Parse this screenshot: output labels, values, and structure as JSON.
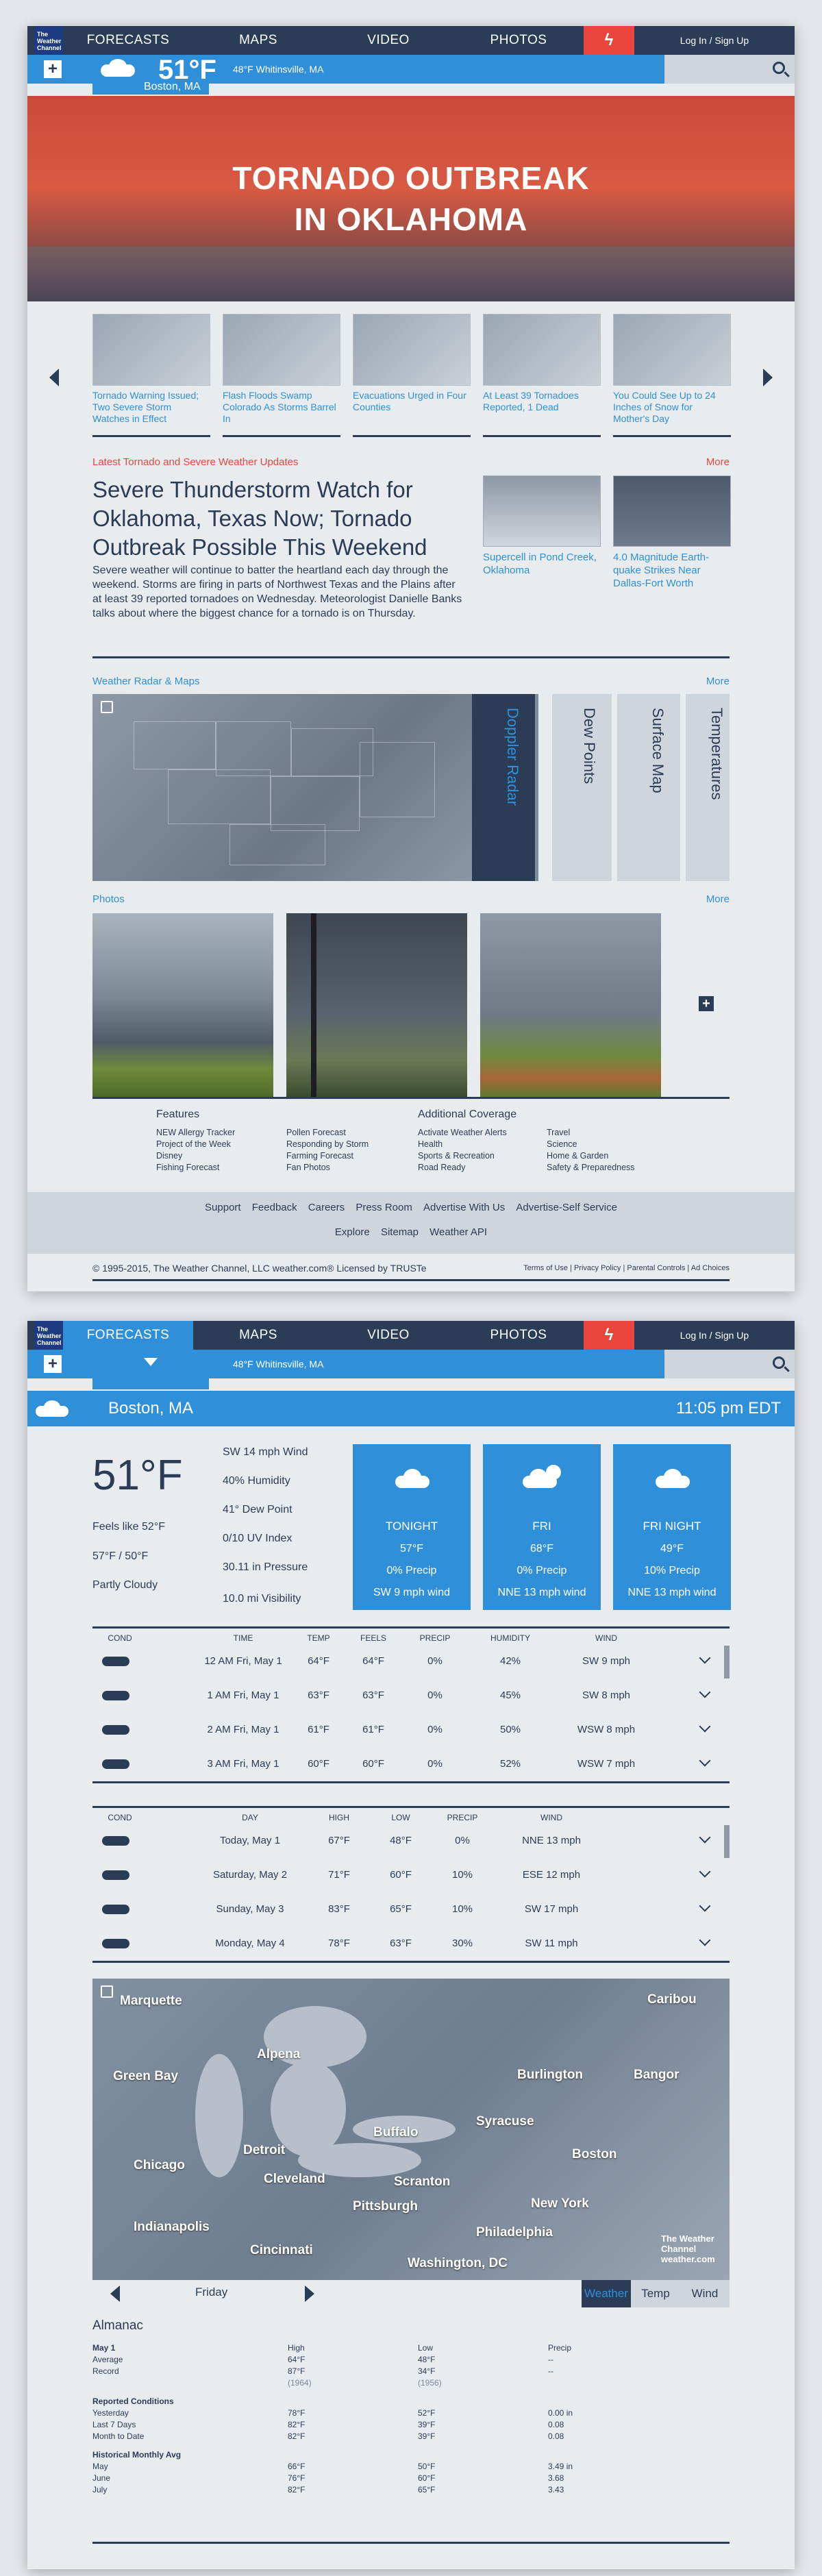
{
  "nav": {
    "logo": "The Weather Channel",
    "items": [
      "FORECASTS",
      "MAPS",
      "VIDEO",
      "PHOTOS"
    ],
    "login": "Log In / Sign Up",
    "location_small": "48°F Whitinsville, MA",
    "plus_glyph": "+",
    "bolt_glyph": "ϟ"
  },
  "current_badge": {
    "temp": "51°F",
    "city": "Boston, MA"
  },
  "hero": {
    "line1": "TORNADO OUTBREAK",
    "line2": "IN OKLAHOMA"
  },
  "thumbs": [
    {
      "caption": "Tornado Warning Issued; Two Severe Storm Watches in Effect"
    },
    {
      "caption": "Flash Floods Swamp Colorado As Storms Barrel In"
    },
    {
      "caption": "Evacuations Urged in Four Counties"
    },
    {
      "caption": "At Least 39 Tornadoes Reported, 1 Dead"
    },
    {
      "caption": "You Could See Up to 24 Inches of Snow for Mother's Day"
    }
  ],
  "latest": {
    "section_title": "Latest Tornado and Severe Weather Updates",
    "more": "More",
    "headline": "Severe Thunderstorm Watch for Oklahoma, Texas Now; Tornado Outbreak Possible This Weekend",
    "dek": "Severe weather will continue to batter the heartland each day through the weekend. Storms are firing in parts of Northwest Texas and the Plains after at least 39 reported tornadoes on Wednesday. Meteorologist Danielle Banks talks about where the biggest chance for a tornado is on Thursday.",
    "side": [
      {
        "caption": "Supercell in Pond Creek, Oklahoma"
      },
      {
        "caption": "4.0 Magnitude Earth-quake Strikes Near Dallas-Fort Worth"
      }
    ]
  },
  "radar": {
    "section_title": "Weather Radar & Maps",
    "more": "More",
    "tabs": [
      "Doppler Radar",
      "Dew Points",
      "Surface Map",
      "Temperatures"
    ]
  },
  "photos": {
    "section_title": "Photos",
    "more": "More",
    "plus_glyph": "+"
  },
  "features": {
    "col1_title": "Features",
    "col1": [
      "NEW Allergy Tracker",
      "Project of the Week",
      "Disney",
      "Fishing Forecast"
    ],
    "col2": [
      "Pollen Forecast",
      "Responding by Storm",
      "Farming Forecast",
      "Fan Photos"
    ],
    "col3_title": "Additional Coverage",
    "col3": [
      "Activate Weather Alerts",
      "Health",
      "Sports & Recreation",
      "Road Ready"
    ],
    "col4": [
      "Travel",
      "Science",
      "Home & Garden",
      "Safety & Preparedness"
    ]
  },
  "footer": {
    "row1": [
      "Support",
      "Feedback",
      "Careers",
      "Press Room",
      "Advertise With Us",
      "Advertise-Self Service"
    ],
    "row2": [
      "Explore",
      "Sitemap",
      "Weather API"
    ],
    "copyright": "© 1995-2015, The Weather Channel, LLC weather.com® Licensed by TRUSTe",
    "legal": "Terms of Use | Privacy Policy | Parental Controls | Ad Choices"
  },
  "page2": {
    "location_bar": {
      "city": "Boston, MA",
      "time": "11:05 pm EDT"
    },
    "current": {
      "temp": "51°F",
      "feels_like": "Feels like 52°F",
      "hi_lo": "57°F / 50°F",
      "condition": "Partly Cloudy",
      "details": [
        "SW 14 mph Wind",
        "40% Humidity",
        "41° Dew Point",
        "0/10 UV Index",
        "30.11 in Pressure",
        "10.0 mi Visibility"
      ]
    },
    "forecast_cards": [
      {
        "name": "TONIGHT",
        "temp": "57°F",
        "precip": "0% Precip",
        "wind": "SW 9 mph wind"
      },
      {
        "name": "FRI",
        "temp": "68°F",
        "precip": "0% Precip",
        "wind": "NNE 13 mph wind"
      },
      {
        "name": "FRI NIGHT",
        "temp": "49°F",
        "precip": "10% Precip",
        "wind": "NNE 13 mph wind"
      }
    ],
    "hourly": {
      "headers": [
        "COND",
        "TIME",
        "TEMP",
        "FEELS",
        "PRECIP",
        "HUMIDITY",
        "WIND"
      ],
      "rows": [
        {
          "time": "12 AM Fri, May 1",
          "temp": "64°F",
          "feels": "64°F",
          "precip": "0%",
          "humidity": "42%",
          "wind": "SW 9 mph"
        },
        {
          "time": "1 AM Fri, May 1",
          "temp": "63°F",
          "feels": "63°F",
          "precip": "0%",
          "humidity": "45%",
          "wind": "SW 8 mph"
        },
        {
          "time": "2 AM Fri, May 1",
          "temp": "61°F",
          "feels": "61°F",
          "precip": "0%",
          "humidity": "50%",
          "wind": "WSW 8 mph"
        },
        {
          "time": "3 AM Fri, May 1",
          "temp": "60°F",
          "feels": "60°F",
          "precip": "0%",
          "humidity": "52%",
          "wind": "WSW 7 mph"
        }
      ]
    },
    "daily": {
      "headers": [
        "COND",
        "DAY",
        "HIGH",
        "LOW",
        "PRECIP",
        "WIND"
      ],
      "rows": [
        {
          "day": "Today, May 1",
          "high": "67°F",
          "low": "48°F",
          "precip": "0%",
          "wind": "NNE 13 mph"
        },
        {
          "day": "Saturday, May 2",
          "high": "71°F",
          "low": "60°F",
          "precip": "10%",
          "wind": "ESE 12 mph"
        },
        {
          "day": "Sunday, May 3",
          "high": "83°F",
          "low": "65°F",
          "precip": "10%",
          "wind": "SW 17 mph"
        },
        {
          "day": "Monday, May 4",
          "high": "78°F",
          "low": "63°F",
          "precip": "30%",
          "wind": "SW 11 mph"
        }
      ]
    },
    "map": {
      "labels": [
        "Marquette",
        "Alpena",
        "Green Bay",
        "Burlington",
        "Bangor",
        "Caribou",
        "Buffalo",
        "Syracuse",
        "Chicago",
        "Detroit",
        "Cleveland",
        "Boston",
        "Scranton",
        "New York",
        "Indianapolis",
        "Pittsburgh",
        "Philadelphia",
        "Cincinnati",
        "Washington, DC"
      ],
      "logo": "The Weather Channel weather.com",
      "day": "Friday",
      "tabs": [
        "Weather",
        "Temp",
        "Wind"
      ]
    },
    "almanac": {
      "title": "Almanac",
      "date_label": "May 1",
      "col_headers": [
        "High",
        "Low",
        "Precip"
      ],
      "average": {
        "label": "Average",
        "high": "64°F",
        "low": "48°F",
        "precip": "--"
      },
      "record": {
        "label": "Record",
        "high": "87°F",
        "low": "34°F",
        "precip": "--",
        "high_year": "(1964)",
        "low_year": "(1956)"
      },
      "reported_title": "Reported Conditions",
      "reported": [
        {
          "label": "Yesterday",
          "high": "78°F",
          "low": "52°F",
          "precip": "0.00 in"
        },
        {
          "label": "Last 7 Days",
          "high": "82°F",
          "low": "39°F",
          "precip": "0.08"
        },
        {
          "label": "Month to Date",
          "high": "82°F",
          "low": "39°F",
          "precip": "0.08"
        }
      ],
      "historical_title": "Historical Monthly Avg",
      "historical": [
        {
          "label": "May",
          "high": "66°F",
          "low": "50°F",
          "precip": "3.49 in"
        },
        {
          "label": "June",
          "high": "76°F",
          "low": "60°F",
          "precip": "3.68"
        },
        {
          "label": "July",
          "high": "82°F",
          "low": "65°F",
          "precip": "3.43"
        }
      ]
    }
  },
  "colors": {
    "navy": "#2b3c57",
    "blue": "#2f8fd8",
    "red": "#e8463c"
  }
}
